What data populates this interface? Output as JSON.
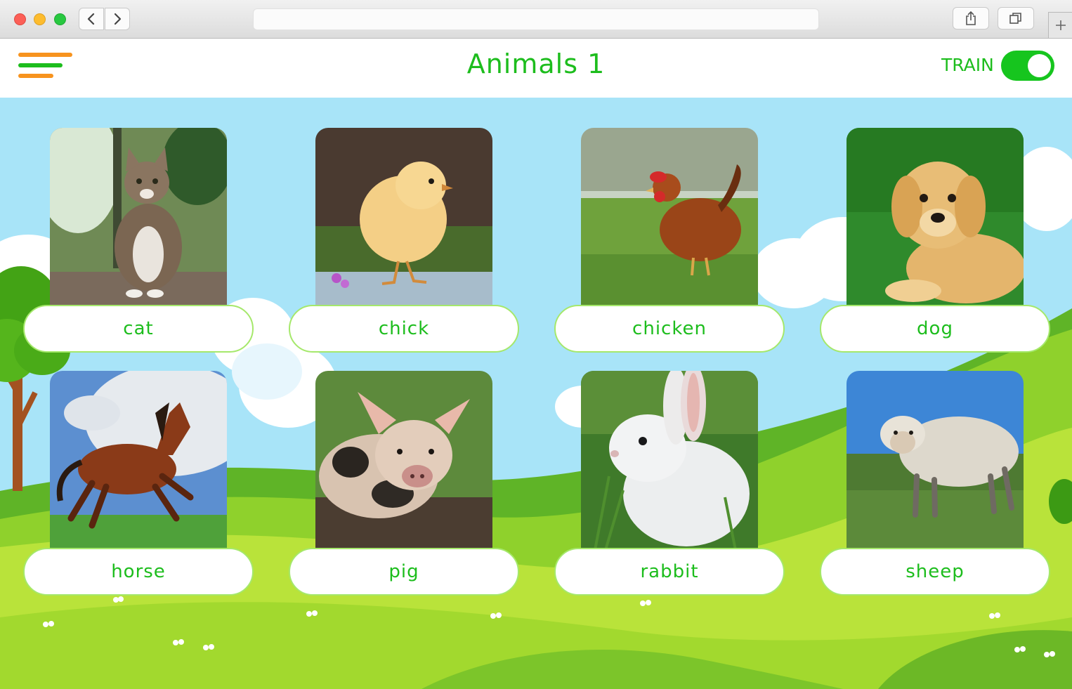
{
  "browser": {
    "back_icon": "chevron-left-icon",
    "forward_icon": "chevron-right-icon",
    "share_icon": "share-icon",
    "tabs_icon": "tabs-icon",
    "new_tab_icon": "plus-icon"
  },
  "app": {
    "title": "Animals 1",
    "menu_icon": "hamburger-menu-icon",
    "menu_colors": [
      "#f7931e",
      "#1dbd1d",
      "#f7931e"
    ],
    "train_label": "TRAIN",
    "train_enabled": true,
    "accent_color": "#1dbd1d"
  },
  "cards": [
    {
      "label": "cat",
      "image": "cat-photo"
    },
    {
      "label": "chick",
      "image": "chick-photo"
    },
    {
      "label": "chicken",
      "image": "chicken-photo"
    },
    {
      "label": "dog",
      "image": "dog-photo"
    },
    {
      "label": "horse",
      "image": "horse-photo"
    },
    {
      "label": "pig",
      "image": "pig-photo"
    },
    {
      "label": "rabbit",
      "image": "rabbit-photo"
    },
    {
      "label": "sheep",
      "image": "sheep-photo"
    }
  ]
}
